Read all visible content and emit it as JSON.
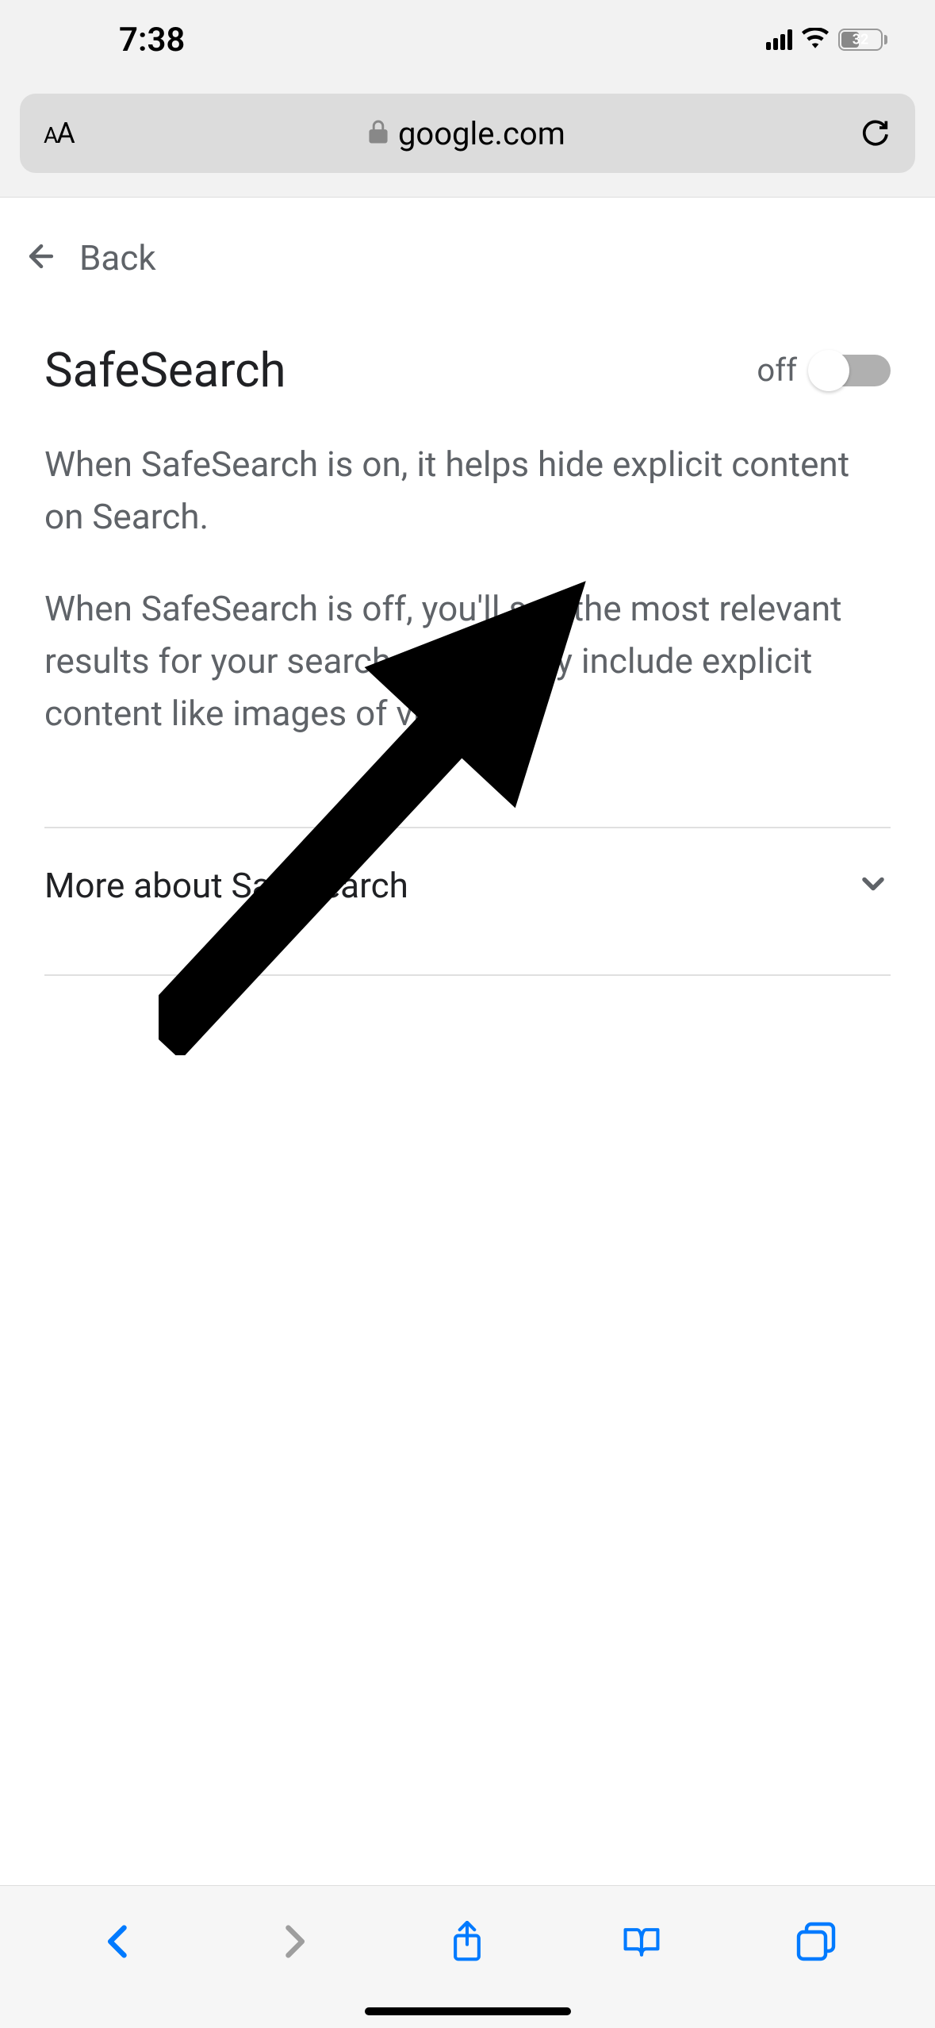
{
  "status_bar": {
    "time": "7:38",
    "battery_pct": "32"
  },
  "url_bar": {
    "domain": "google.com"
  },
  "nav": {
    "back_label": "Back"
  },
  "page": {
    "heading": "SafeSearch",
    "toggle_state": "off",
    "desc_on": "When SafeSearch is on, it helps hide explicit content on Search.",
    "desc_off": "When SafeSearch is off, you'll see the most relevant results for your search, which may include explicit content like images of violence.",
    "more_label": "More about SafeSearch"
  }
}
